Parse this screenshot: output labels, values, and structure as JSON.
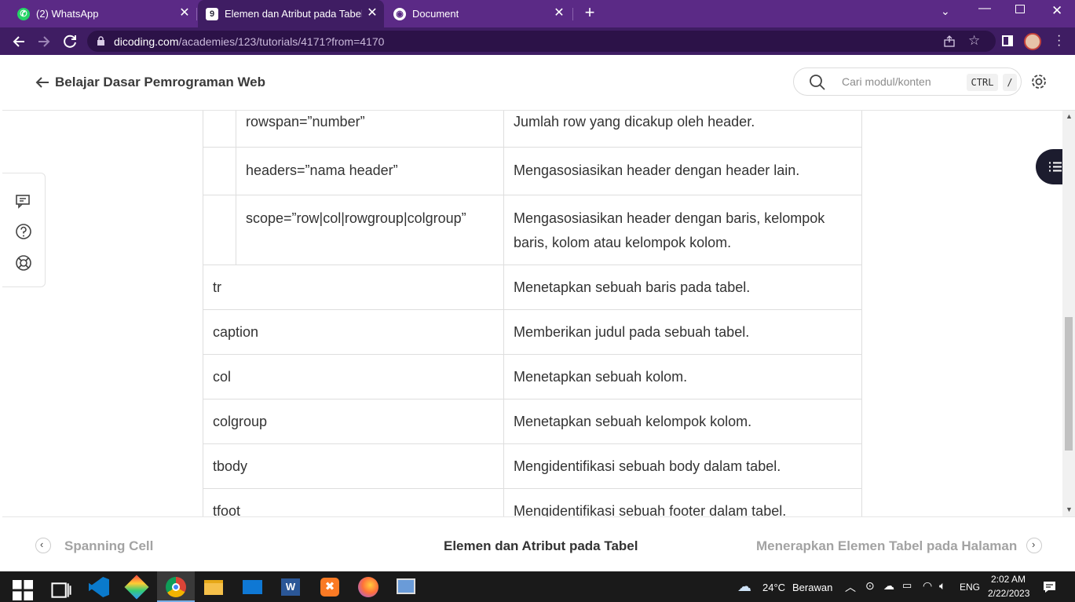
{
  "browser": {
    "tabs": [
      {
        "title": "(2) WhatsApp",
        "active": false
      },
      {
        "title": "Elemen dan Atribut pada Tabel | D",
        "active": true
      },
      {
        "title": "Document",
        "active": false
      }
    ],
    "url_host": "dicoding.com",
    "url_path": "/academies/123/tutorials/4171?from=4170"
  },
  "header": {
    "course_title": "Belajar Dasar Pemrograman Web",
    "search_placeholder": "Cari modul/konten",
    "shortcut_ctrl": "CTRL",
    "shortcut_slash": "/"
  },
  "table": {
    "attr_rows": [
      {
        "attr": "rowspan=”number”",
        "desc": "Jumlah row yang dicakup oleh header."
      },
      {
        "attr": "headers=”nama header”",
        "desc": "Mengasosiasikan header dengan header lain."
      },
      {
        "attr": "scope=”row|col|rowgroup|colgroup”",
        "desc_line1": "Mengasosiasikan header dengan baris, kelompok",
        "desc_line2": "baris, kolom atau kelompok kolom."
      }
    ],
    "rows": [
      {
        "elem": "tr",
        "desc": "Menetapkan sebuah baris pada tabel."
      },
      {
        "elem": "caption",
        "desc": "Memberikan judul pada sebuah tabel."
      },
      {
        "elem": "col",
        "desc": "Menetapkan sebuah kolom."
      },
      {
        "elem": "colgroup",
        "desc": "Menetapkan sebuah kelompok kolom."
      },
      {
        "elem": "tbody",
        "desc": "Mengidentifikasi sebuah body dalam tabel."
      },
      {
        "elem": "tfoot",
        "desc": "Mengidentifikasi sebuah footer dalam tabel."
      }
    ]
  },
  "footer": {
    "prev": "Spanning Cell",
    "current": "Elemen dan Atribut pada Tabel",
    "next": "Menerapkan Elemen Tabel pada Halaman"
  },
  "taskbar": {
    "weather_temp": "24°C",
    "weather_desc": "Berawan",
    "lang": "ENG",
    "time": "2:02 AM",
    "date": "2/22/2023"
  },
  "colors": {
    "chrome_purple": "#5b2a86",
    "chrome_dark": "#3f1d63",
    "text": "#333333"
  }
}
